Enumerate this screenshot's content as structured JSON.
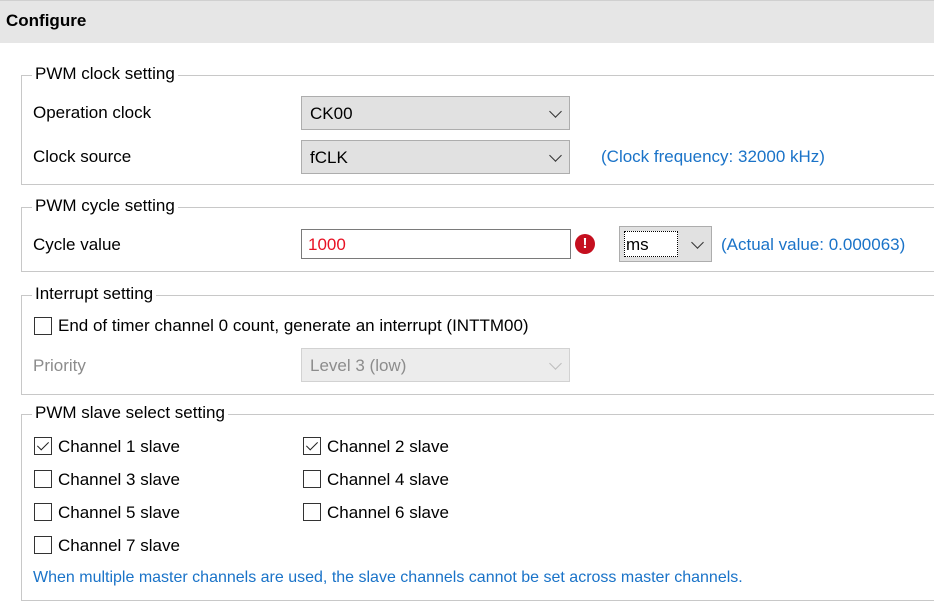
{
  "header": {
    "title": "Configure"
  },
  "pwm_clock": {
    "legend": "PWM clock setting",
    "operation_clock_label": "Operation clock",
    "operation_clock_value": "CK00",
    "clock_source_label": "Clock source",
    "clock_source_value": "fCLK",
    "clock_frequency_note": "(Clock frequency: 32000 kHz)"
  },
  "pwm_cycle": {
    "legend": "PWM cycle setting",
    "cycle_label": "Cycle value",
    "cycle_value": "1000",
    "error_icon": "error-exclamation-icon",
    "unit_value": "ms",
    "actual_value_note": "(Actual value: 0.000063)"
  },
  "interrupt": {
    "legend": "Interrupt setting",
    "generate_interrupt_label": "End of timer channel 0 count, generate an interrupt (INTTM00)",
    "generate_interrupt_checked": false,
    "priority_label": "Priority",
    "priority_value": "Level 3 (low)"
  },
  "slave_select": {
    "legend": "PWM slave select setting",
    "channels": [
      {
        "label": "Channel 1 slave",
        "checked": true
      },
      {
        "label": "Channel 2 slave",
        "checked": true
      },
      {
        "label": "Channel 3 slave",
        "checked": false
      },
      {
        "label": "Channel 4 slave",
        "checked": false
      },
      {
        "label": "Channel 5 slave",
        "checked": false
      },
      {
        "label": "Channel 6 slave",
        "checked": false
      },
      {
        "label": "Channel 7 slave",
        "checked": false
      }
    ],
    "note": "When multiple master channels are used, the slave channels cannot be set across master channels."
  },
  "colors": {
    "header_bg": "#e6e6e6",
    "note_blue": "#1a73c8",
    "error_red": "#e81123",
    "error_icon_red": "#c50f1f"
  }
}
